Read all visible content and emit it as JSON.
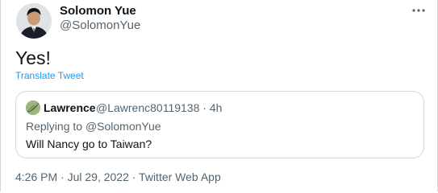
{
  "author": {
    "name": "Solomon Yue",
    "handle": "@SolomonYue"
  },
  "tweet": {
    "text": "Yes!",
    "translate_label": "Translate Tweet"
  },
  "quoted": {
    "name": "Lawrence",
    "handle_time": "@Lawrenc80119138 · 4h",
    "reply_prefix": "Replying to ",
    "reply_to": "@SolomonYue",
    "text": "Will Nancy go to Taiwan?"
  },
  "meta": {
    "timestamp": "4:26 PM · Jul 29, 2022 · Twitter Web App"
  },
  "icons": {
    "more": "more-horizontal-icon"
  },
  "colors": {
    "link": "#1d9bf0",
    "secondary_text": "#536471",
    "border": "#cfd9de"
  }
}
